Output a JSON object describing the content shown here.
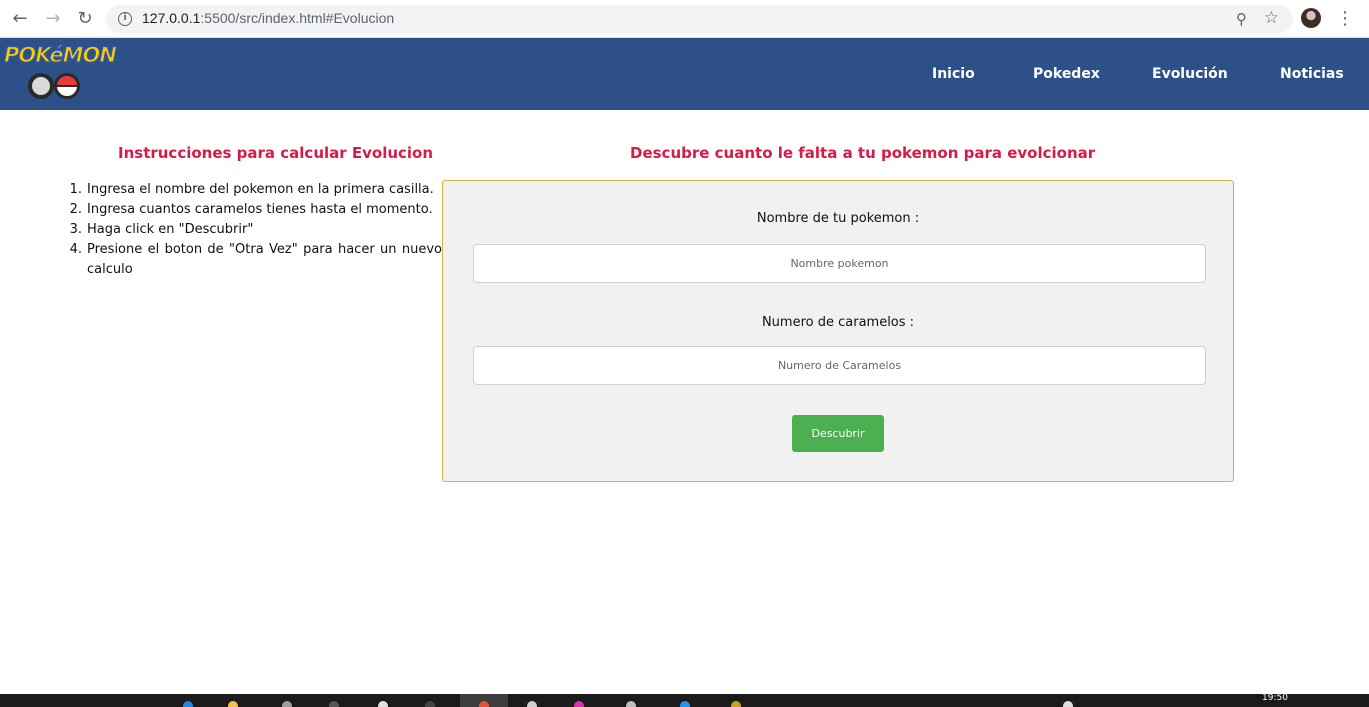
{
  "browser": {
    "url_host": "127.0.0.1",
    "url_rest": ":5500/src/index.html#Evolucion",
    "back_icon": "arrow-left-icon",
    "forward_icon": "arrow-right-icon",
    "reload_icon": "reload-icon"
  },
  "header": {
    "logo_top": "POKéMON",
    "nav": {
      "inicio": "Inicio",
      "pokedex": "Pokedex",
      "evolucion": "Evolución",
      "noticias": "Noticias"
    }
  },
  "instructions": {
    "title": "Instrucciones para calcular Evolucion",
    "items": [
      {
        "num": "1.",
        "text": "Ingresa el nombre del pokemon en la primera casilla."
      },
      {
        "num": "2.",
        "text": "Ingresa cuantos caramelos tienes hasta el momento."
      },
      {
        "num": "3.",
        "text": "Haga click en \"Descubrir\""
      },
      {
        "num": "4.",
        "text": "Presione el boton de \"Otra Vez\" para hacer un nuevo calculo"
      }
    ]
  },
  "calculator": {
    "title": "Descubre cuanto le falta a tu pokemon para evolcionar",
    "name_label": "Nombre de tu pokemon :",
    "name_placeholder": "Nombre pokemon",
    "candies_label": "Numero de caramelos :",
    "candies_placeholder": "Numero de Caramelos",
    "button_label": "Descubrir"
  },
  "taskbar": {
    "clock": "19:50"
  },
  "colors": {
    "header_bg": "#2c5087",
    "title_red": "#d81b46",
    "button_green": "#4caf50",
    "box_border": "#d9b23a"
  }
}
